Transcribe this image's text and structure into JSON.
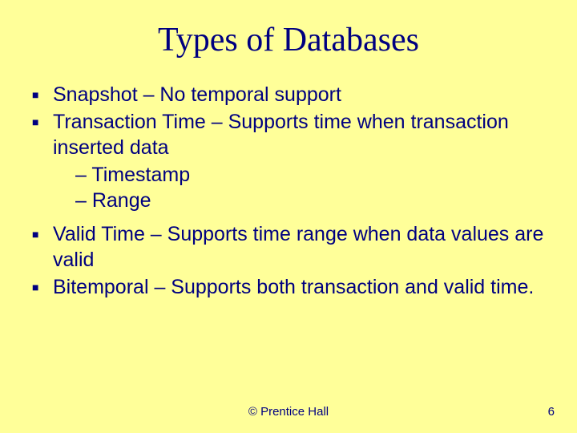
{
  "title": "Types of Databases",
  "bullets": {
    "b1": "Snapshot – No temporal support",
    "b2": "Transaction Time – Supports time when transaction inserted data",
    "b2s1": "– Timestamp",
    "b2s2": "– Range",
    "b3": "Valid Time – Supports time range when data values are valid",
    "b4": "Bitemporal – Supports both transaction and valid time."
  },
  "footer": {
    "center": "© Prentice Hall",
    "pageNumber": "6"
  }
}
